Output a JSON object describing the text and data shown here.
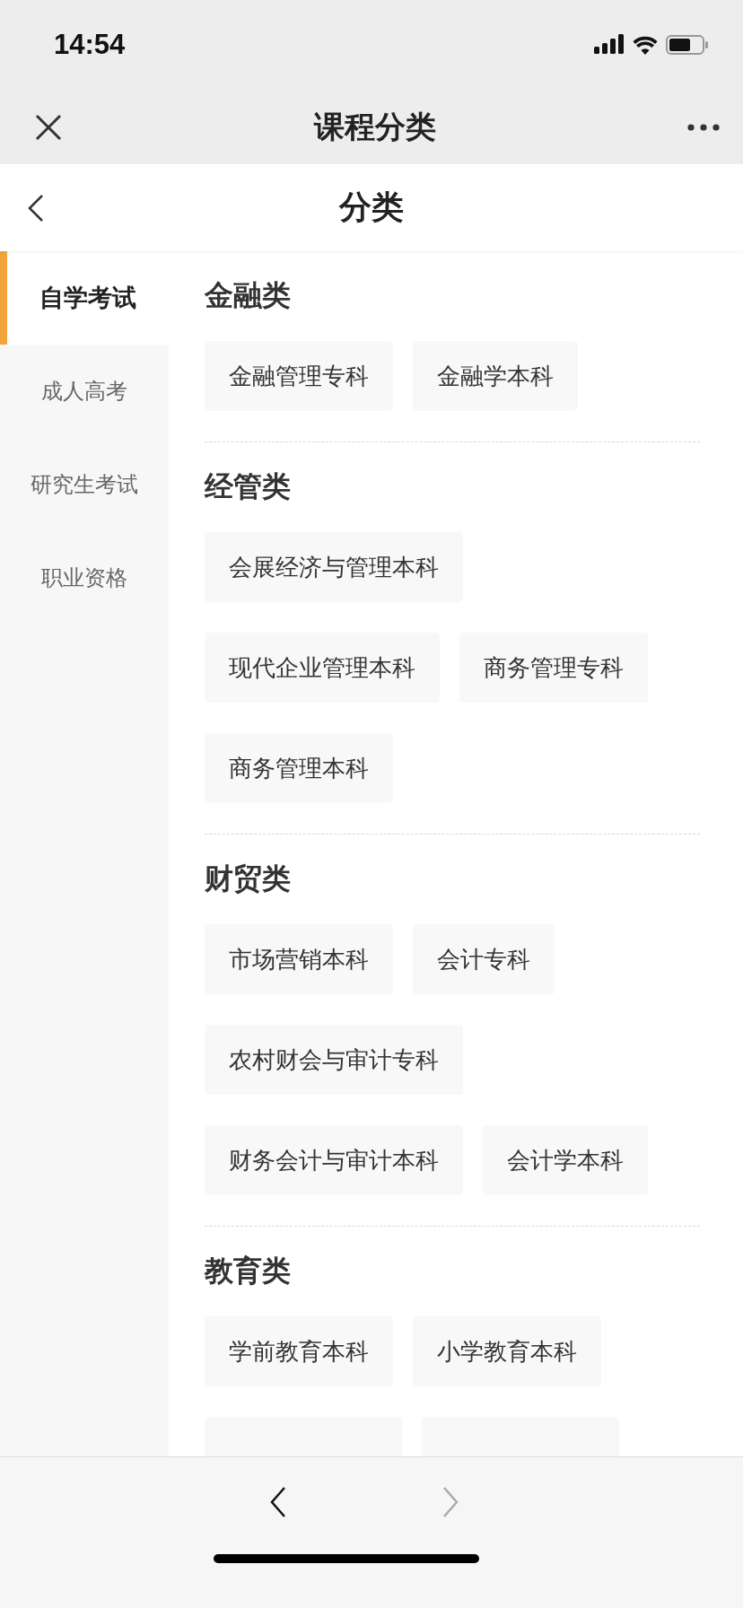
{
  "status_bar": {
    "time": "14:54"
  },
  "nav_bar": {
    "title": "课程分类"
  },
  "header": {
    "title": "分类"
  },
  "sidebar": {
    "items": [
      {
        "label": "自学考试",
        "selected": true
      },
      {
        "label": "成人高考",
        "selected": false
      },
      {
        "label": "研究生考试",
        "selected": false
      },
      {
        "label": "职业资格",
        "selected": false
      }
    ]
  },
  "sections": [
    {
      "title": "金融类",
      "items": [
        {
          "kind": "chip",
          "label": "金融管理专科"
        },
        {
          "kind": "chip",
          "label": "金融学本科"
        }
      ]
    },
    {
      "title": "经管类",
      "items": [
        {
          "kind": "chip",
          "label": "会展经济与管理本科"
        },
        {
          "kind": "chip",
          "label": "现代企业管理本科"
        },
        {
          "kind": "chip",
          "label": "商务管理专科"
        },
        {
          "kind": "chip",
          "label": "商务管理本科"
        }
      ]
    },
    {
      "title": "财贸类",
      "items": [
        {
          "kind": "chip",
          "label": "市场营销本科"
        },
        {
          "kind": "chip",
          "label": "会计专科"
        },
        {
          "kind": "chip",
          "label": "农村财会与审计专科"
        },
        {
          "kind": "chip",
          "label": "财务会计与审计本科"
        },
        {
          "kind": "chip",
          "label": "会计学本科"
        }
      ]
    },
    {
      "title": "教育类",
      "items": [
        {
          "kind": "chip",
          "label": "学前教育本科"
        },
        {
          "kind": "chip",
          "label": "小学教育本科"
        },
        {
          "kind": "partial"
        },
        {
          "kind": "partial"
        }
      ]
    }
  ],
  "toolbar": {
    "back_enabled": true,
    "forward_enabled": false
  }
}
